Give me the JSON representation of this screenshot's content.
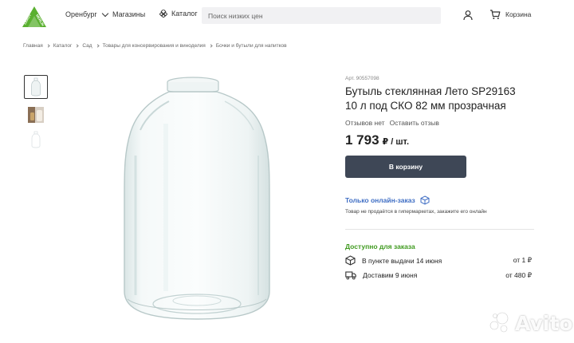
{
  "header": {
    "city": "Оренбург",
    "stores": "Магазины",
    "catalog": "Каталог",
    "search_placeholder": "Поиск низких цен",
    "cart": "Корзина",
    "logo_text": "LEROY MERLIN"
  },
  "breadcrumb": [
    "Главная",
    "Каталог",
    "Сад",
    "Товары для консервирования и виноделия",
    "Бочки и бутыли для напитков"
  ],
  "product": {
    "article": "Арт. 90557098",
    "title_line1": "Бутыль стеклянная Лето SP29163",
    "title_line2": "10 л под СКО 82 мм прозрачная",
    "reviews": "Отзывов нет",
    "leave_review": "Оставить отзыв",
    "price": "1 793",
    "price_unit": "₽ / шт.",
    "add_to_cart": "В корзину",
    "online_only": "Только онлайн-заказ",
    "online_note": "Товар не продаётся в гипермаркетах, закажите его онлайн",
    "available": "Доступно для заказа",
    "delivery": [
      {
        "icon": "box-icon",
        "label": "В пункте выдачи 14 июня",
        "value": "от 1 ₽"
      },
      {
        "icon": "truck-icon",
        "label": "Доставим 9 июня",
        "value": "от 480 ₽"
      }
    ]
  },
  "watermark": "Avito",
  "colors": {
    "button": "#3e4756",
    "online_link": "#3f6ec4",
    "available": "#3f9a1f",
    "logo_green": "#5ab030"
  }
}
